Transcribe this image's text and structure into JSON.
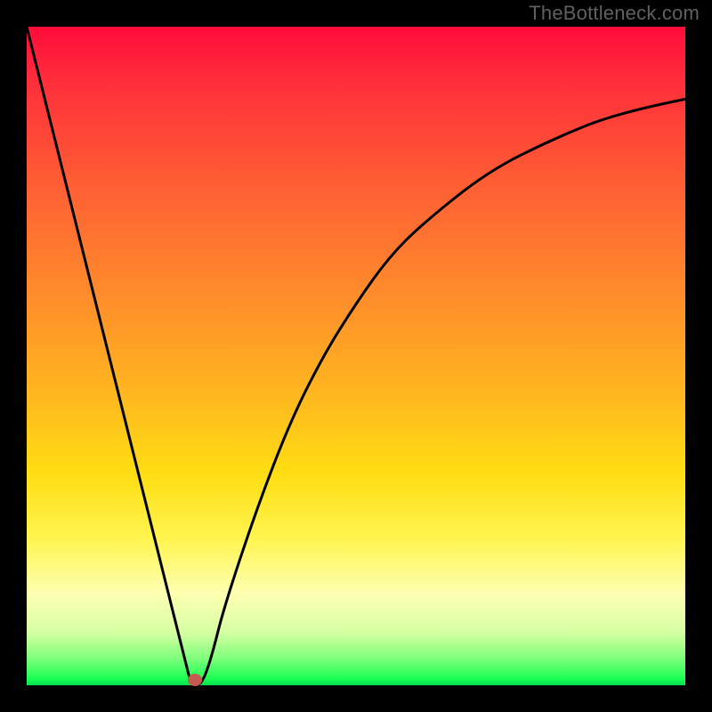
{
  "watermark": "TheBottleneck.com",
  "chart_data": {
    "type": "line",
    "title": "",
    "xlabel": "",
    "ylabel": "",
    "xlim": [
      0,
      100
    ],
    "ylim": [
      0,
      100
    ],
    "grid": false,
    "axes_visible": false,
    "background_gradient": {
      "direction": "top-to-bottom",
      "stops": [
        {
          "pos": 0,
          "color": "#ff0b3b"
        },
        {
          "pos": 24,
          "color": "#ff5e34"
        },
        {
          "pos": 56,
          "color": "#ffb71f"
        },
        {
          "pos": 78,
          "color": "#fff552"
        },
        {
          "pos": 92,
          "color": "#d6ffa2"
        },
        {
          "pos": 100,
          "color": "#04e04e"
        }
      ]
    },
    "series": [
      {
        "name": "bottleneck-curve",
        "style": "solid",
        "color": "#000000",
        "width": 3,
        "x": [
          0,
          5,
          10,
          15,
          20,
          24,
          25,
          26.5,
          28,
          30,
          35,
          40,
          45,
          50,
          55,
          60,
          70,
          80,
          90,
          100
        ],
        "y": [
          100,
          80,
          60,
          40,
          20,
          4,
          0,
          0,
          4,
          12,
          27,
          40,
          50,
          58,
          65,
          70,
          78,
          83,
          87,
          89
        ]
      }
    ],
    "marker": {
      "shape": "ellipse",
      "color": "#c75a4e",
      "x": 25.5,
      "y": 0.8
    }
  }
}
